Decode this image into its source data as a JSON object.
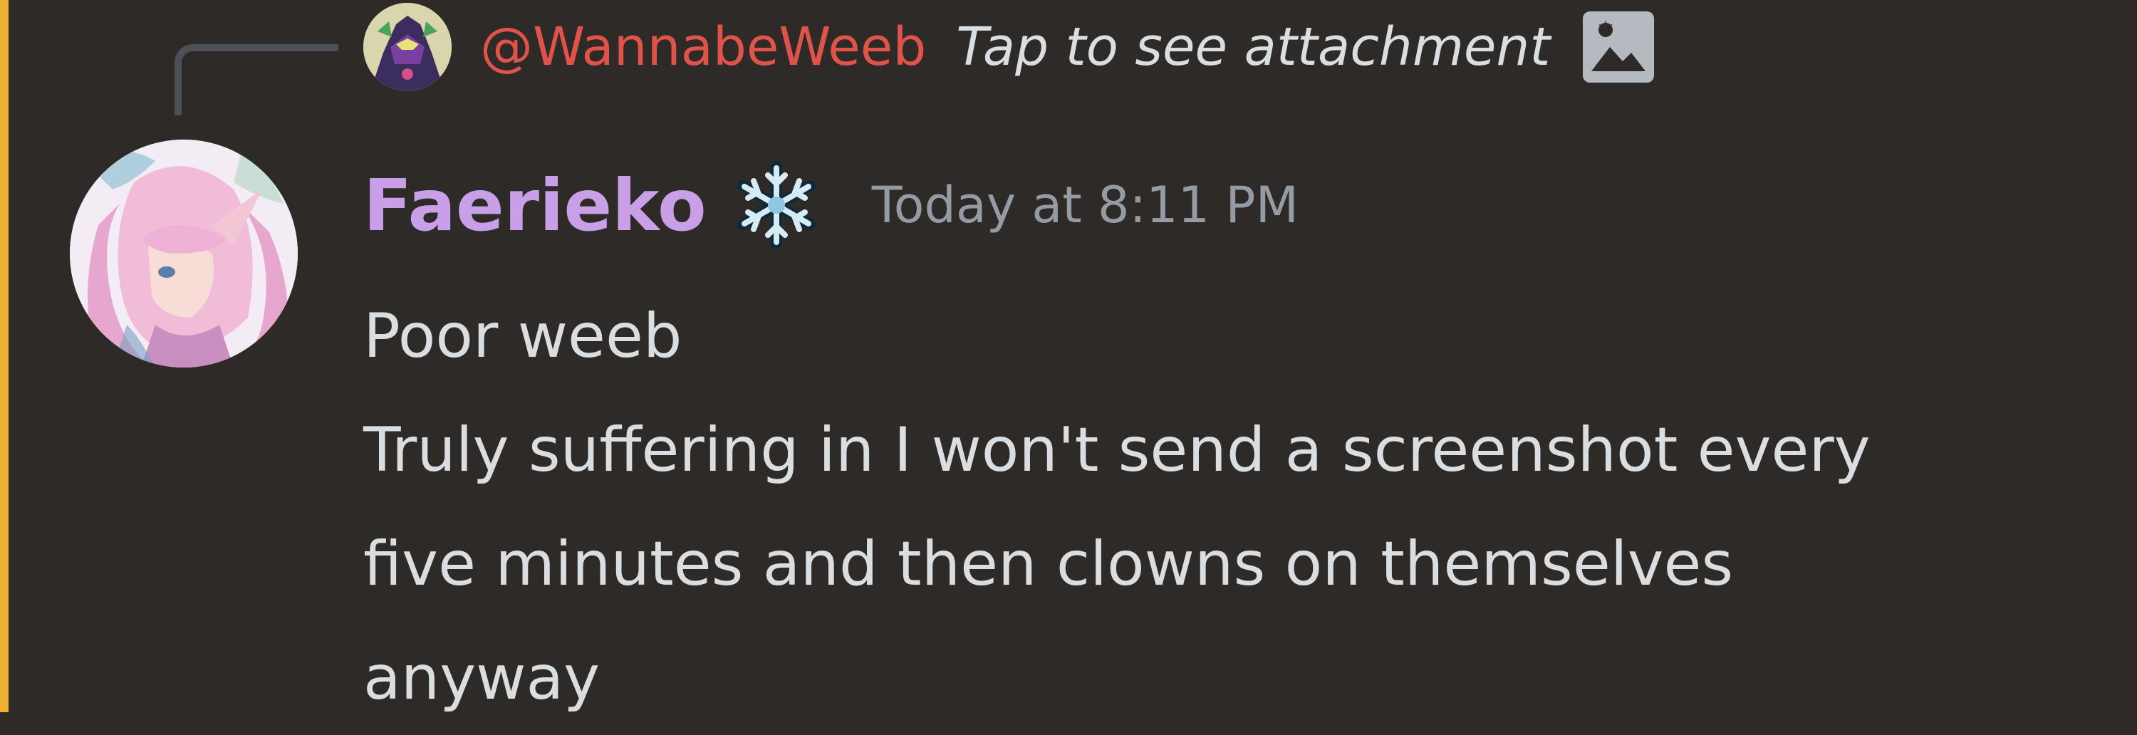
{
  "theme": {
    "background": "#2d2a27",
    "mention_highlight_bar": "#f0b232",
    "reply_author_color": "#e0534a",
    "author_name_color": "#c9a0e8",
    "timestamp_color": "#949ba4",
    "body_text_color": "#dbdee1"
  },
  "reply": {
    "author": "@WannabeWeeb",
    "preview": "Tap to see attachment",
    "attachment_icon": "image-icon",
    "avatar_icon": "avatar"
  },
  "message": {
    "author": "Faerieko",
    "role_icon": "snowflake-icon",
    "timestamp": "Today at 8:11 PM",
    "lines": [
      "Poor weeb",
      "Truly suffering in I won't send a screenshot every",
      "five minutes and then clowns on themselves",
      "anyway"
    ]
  }
}
